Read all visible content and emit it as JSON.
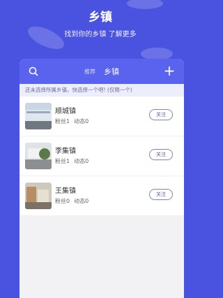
{
  "header": {
    "title": "乡镇",
    "subtitle": "找到你的乡镇 了解更多"
  },
  "topbar": {
    "tab_recommend": "推荐",
    "tab_town": "乡镇",
    "search_icon": "search-icon",
    "add_icon": "plus-icon"
  },
  "notice": "还未选择所属乡镇，快选择一个吧! (仅限一个)",
  "towns": [
    {
      "name": "顺城镇",
      "fans": "粉丝1",
      "posts": "动态0",
      "follow_label": "关注"
    },
    {
      "name": "李集镇",
      "fans": "粉丝1",
      "posts": "动态0",
      "follow_label": "关注"
    },
    {
      "name": "王集镇",
      "fans": "粉丝0",
      "posts": "动态0",
      "follow_label": "关注"
    }
  ],
  "colors": {
    "background": "#4a53e0",
    "topbar": "#5a63ee",
    "follow_border": "#7a86b8"
  }
}
